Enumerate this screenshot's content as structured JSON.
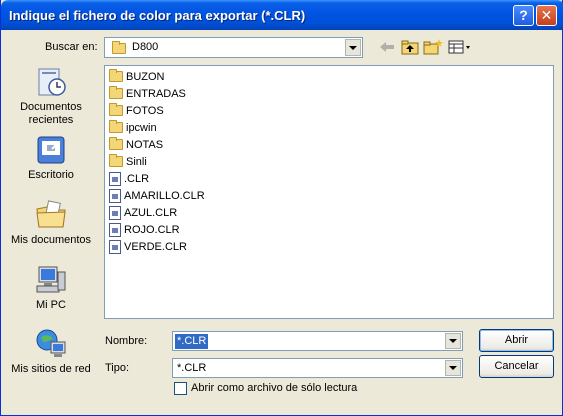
{
  "window": {
    "title": "Indique el fichero de color para exportar (*.CLR)",
    "help_label": "?",
    "close_label": "✕"
  },
  "lookin": {
    "label": "Buscar en:",
    "value": "D800"
  },
  "toolbar": {
    "icons": [
      "back-arrow-icon",
      "up-folder-icon",
      "new-folder-icon",
      "view-menu-icon"
    ]
  },
  "places": [
    {
      "label_lines": [
        "Documentos",
        "recientes"
      ],
      "icon": "recent-documents-icon"
    },
    {
      "label_lines": [
        "Escritorio"
      ],
      "icon": "desktop-icon"
    },
    {
      "label_lines": [
        "Mis documentos"
      ],
      "icon": "my-documents-icon"
    },
    {
      "label_lines": [
        "Mi PC"
      ],
      "icon": "my-computer-icon"
    },
    {
      "label_lines": [
        "Mis sitios de red"
      ],
      "icon": "network-places-icon"
    }
  ],
  "files": [
    {
      "name": "BUZON",
      "type": "folder"
    },
    {
      "name": "ENTRADAS",
      "type": "folder"
    },
    {
      "name": "FOTOS",
      "type": "folder"
    },
    {
      "name": "ipcwin",
      "type": "folder"
    },
    {
      "name": "NOTAS",
      "type": "folder"
    },
    {
      "name": "Sinli",
      "type": "folder"
    },
    {
      "name": ".CLR",
      "type": "file"
    },
    {
      "name": "AMARILLO.CLR",
      "type": "file"
    },
    {
      "name": "AZUL.CLR",
      "type": "file"
    },
    {
      "name": "ROJO.CLR",
      "type": "file"
    },
    {
      "name": "VERDE.CLR",
      "type": "file"
    }
  ],
  "filename": {
    "label": "Nombre:",
    "value": "*.CLR"
  },
  "filetype": {
    "label": "Tipo:",
    "value": "*.CLR"
  },
  "readonly": {
    "label": "Abrir como archivo de sólo lectura",
    "checked": false
  },
  "buttons": {
    "open": "Abrir",
    "cancel": "Cancelar"
  },
  "colors": {
    "titlebar": "#0054e3",
    "selection": "#316ac5",
    "dialog_bg": "#ece9d8"
  }
}
